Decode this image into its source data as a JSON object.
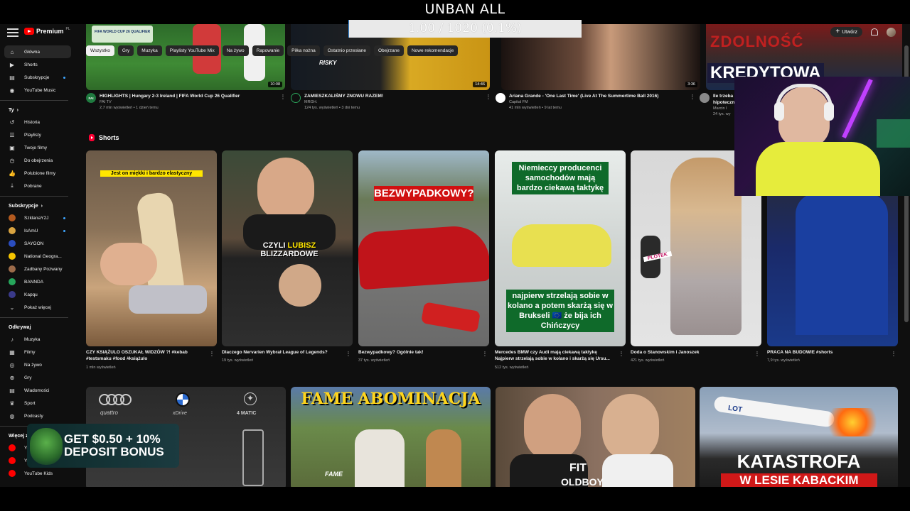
{
  "overlay": {
    "title": "UNBAN ALL",
    "progress_text": "1.00 / 1020 (0.1%)",
    "progress_fraction": 0.001
  },
  "topbar": {
    "logo_text": "Premium",
    "logo_suffix": "PL",
    "create_label": "Utwórz"
  },
  "chips": [
    "Wszystko",
    "Gry",
    "Muzyka",
    "Playlisty YouTube Mix",
    "Na żywo",
    "Rapowanie",
    "Piłka nożna",
    "Ostatnio przesłane",
    "Obejrzane",
    "Nowe rekomendacje"
  ],
  "sidebar": {
    "main": [
      {
        "label": "Główna",
        "icon": "home-icon"
      },
      {
        "label": "Shorts",
        "icon": "shorts-icon"
      },
      {
        "label": "Subskrypcje",
        "icon": "subscriptions-icon"
      },
      {
        "label": "YouTube Music",
        "icon": "music-icon"
      }
    ],
    "you_header": "Ty",
    "you": [
      {
        "label": "Historia",
        "icon": "history-icon"
      },
      {
        "label": "Playlisty",
        "icon": "playlist-icon"
      },
      {
        "label": "Twoje filmy",
        "icon": "your-videos-icon"
      },
      {
        "label": "Do obejrzenia",
        "icon": "watch-later-icon"
      },
      {
        "label": "Polubione filmy",
        "icon": "like-icon"
      },
      {
        "label": "Pobrane",
        "icon": "download-icon"
      }
    ],
    "subs_header": "Subskrypcje",
    "subs": [
      {
        "label": "SzklanaY2J",
        "color": "#b35a1f"
      },
      {
        "label": "IsAmU",
        "color": "#d9a441"
      },
      {
        "label": "SAYGON",
        "color": "#2a4dbf"
      },
      {
        "label": "National Geogra...",
        "color": "#f5c400"
      },
      {
        "label": "Zadbany Pozwany",
        "color": "#9c6b4a"
      },
      {
        "label": "BANNDA",
        "color": "#26a65b"
      },
      {
        "label": "Kapqu",
        "color": "#3a3a8a"
      }
    ],
    "show_more": "Pokaż więcej",
    "explore_header": "Odkrywaj",
    "explore": [
      {
        "label": "Muzyka",
        "icon": "music-note-icon"
      },
      {
        "label": "Filmy",
        "icon": "film-icon"
      },
      {
        "label": "Na żywo",
        "icon": "live-icon"
      },
      {
        "label": "Gry",
        "icon": "gamepad-icon"
      },
      {
        "label": "Wiadomości",
        "icon": "news-icon"
      },
      {
        "label": "Sport",
        "icon": "trophy-icon"
      },
      {
        "label": "Podcasty",
        "icon": "podcast-icon"
      }
    ],
    "more_header": "Więcej z",
    "more": [
      {
        "label": "Y",
        "color": "#ff0000"
      },
      {
        "label": "Y",
        "color": "#ff0000"
      },
      {
        "label": "YouTube Kids",
        "color": "#ff0000"
      }
    ]
  },
  "row1": [
    {
      "title": "HIGHLIGHTS | Hungary 2-3 Ireland | FIFA World Cup 26 Qualifier",
      "channel": "FAI TV",
      "stats": "2,7 mln wyświetleń • 1 dzień temu",
      "duration": "10:08",
      "avatar_text": "FAI"
    },
    {
      "title": "ZAMIESZKALIŚMY ZNOWU RAZEM!",
      "channel": "MRGH.",
      "stats": "124 tys. wyświetleń • 3 dni temu",
      "duration": "14:46",
      "avatar_text": ""
    },
    {
      "title": "Ariana Grande - 'One Last Time' (Live At The Summertime Ball 2016)",
      "channel": "Capital FM",
      "stats": "41 mln wyświetleń • 9 lat temu",
      "duration": "3:36",
      "avatar_text": ""
    },
    {
      "title": "Ile trzeba",
      "title2": "hipoteczn",
      "channel": "Marcin I",
      "stats": "24 tys. wy",
      "duration": "",
      "avatar_text": ""
    }
  ],
  "row1_thumb_texts": {
    "fifa": "FIFA WORLD CUP 26 QUALIFIER",
    "risky": "RISKY",
    "zdolnosc": "ZDOLNOŚĆ",
    "kredytowa": "KREDYTOWA"
  },
  "shorts_header": "Shorts",
  "shorts": [
    {
      "caption": "CZY KSIĄŻULO OSZUKAŁ WIDZÓW ?! #kebab #testsmaku #food #książulo",
      "views": "1 mln wyświetleń",
      "overlay": "Jest on miękki i bardzo elastyczny"
    },
    {
      "caption": "Dlaczego Nervarien Wybrał League of Legends?",
      "views": "19 tys. wyświetleń",
      "overlay": "CZYLI LUBISZ BLIZZARDOWE",
      "overlay_a": "CZYLI",
      "overlay_b": "LUBISZ",
      "overlay_c": "BLIZZARDOWE"
    },
    {
      "caption": "Bezwypadkowy? Ogólnie tak!",
      "views": "37 tys. wyświetleń",
      "overlay": "BEZWYPADKOWY?"
    },
    {
      "caption": "Mercedes BMW czy Audi mają ciekawą taktykę Najpierw strzelają sobie w kolano i skarżą się Ursu...",
      "views": "512 tys. wyświetleń",
      "overlay_top": "Niemieccy producenci samochodów mają bardzo ciekawą taktykę",
      "overlay_bottom": "najpierw strzelają sobie w kolano a potem skarżą się w Brukseli 🇪🇺 że bija ich Chińczycy"
    },
    {
      "caption": "Doda o Stanowskim i Janoszek",
      "views": "421 tys. wyświetleń",
      "overlay": "PLOTEK"
    },
    {
      "caption": "PRACA NA BUDOWIE #shorts",
      "views": "7,9 tys. wyświetleń",
      "overlay": ""
    }
  ],
  "row3": [
    {
      "overlay": "",
      "brands": [
        "quattro",
        "xDrive",
        "4 MATIC"
      ]
    },
    {
      "overlay": "FAME ABOMINACJA",
      "sub": "FAME"
    },
    {
      "overlay": "FIT",
      "sub": "OLDBOY"
    },
    {
      "overlay": "KATASTROFA",
      "sub": "W LESIE KABACKIM",
      "plane": "LOT"
    }
  ],
  "ad": {
    "line1": "GET $0.50 + 10%",
    "line2": "DEPOSIT BONUS"
  },
  "colors": {
    "bg": "#0f0f0f",
    "chip": "#272727",
    "accent_red": "#ff0000",
    "progress_blue": "#3a8dde"
  }
}
